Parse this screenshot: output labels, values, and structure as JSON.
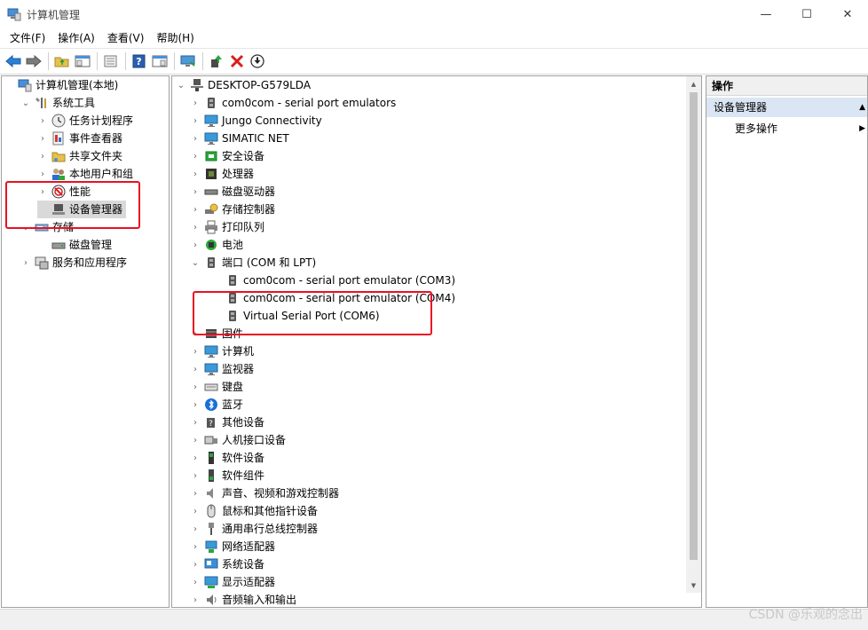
{
  "window": {
    "title": "计算机管理",
    "minimize": "—",
    "maximize": "☐",
    "close": "✕"
  },
  "menu": [
    "文件(F)",
    "操作(A)",
    "查看(V)",
    "帮助(H)"
  ],
  "toolbar_icons": [
    "back-arrow-icon",
    "forward-arrow-icon",
    "up-folder-icon",
    "show-hide-tree-icon",
    "properties-icon",
    "help-icon",
    "action-pane-icon",
    "monitor-icon",
    "update-driver-icon",
    "uninstall-icon",
    "download-icon"
  ],
  "left_tree": [
    {
      "label": "计算机管理(本地)",
      "arrow": "",
      "depth": 0,
      "icon": "computer-management-icon"
    },
    {
      "label": "系统工具",
      "arrow": "⌄",
      "depth": 1,
      "icon": "tools-icon"
    },
    {
      "label": "任务计划程序",
      "arrow": "›",
      "depth": 2,
      "icon": "clock-icon"
    },
    {
      "label": "事件查看器",
      "arrow": "›",
      "depth": 2,
      "icon": "event-viewer-icon"
    },
    {
      "label": "共享文件夹",
      "arrow": "›",
      "depth": 2,
      "icon": "shared-folder-icon"
    },
    {
      "label": "本地用户和组",
      "arrow": "›",
      "depth": 2,
      "icon": "users-icon"
    },
    {
      "label": "性能",
      "arrow": "›",
      "depth": 2,
      "icon": "performance-icon"
    },
    {
      "label": "设备管理器",
      "arrow": "",
      "depth": 2,
      "icon": "device-manager-icon",
      "selected": true
    },
    {
      "label": "存储",
      "arrow": "⌄",
      "depth": 1,
      "icon": "storage-icon"
    },
    {
      "label": "磁盘管理",
      "arrow": "",
      "depth": 2,
      "icon": "disk-icon"
    },
    {
      "label": "服务和应用程序",
      "arrow": "›",
      "depth": 1,
      "icon": "services-icon"
    }
  ],
  "device_tree": {
    "root": "DESKTOP-G579LDA",
    "items": [
      {
        "label": "com0com - serial port emulators",
        "depth": 1,
        "arrow": "›",
        "icon": "port-icon"
      },
      {
        "label": "Jungo Connectivity",
        "depth": 1,
        "arrow": "›",
        "icon": "monitor-icon"
      },
      {
        "label": "SIMATIC NET",
        "depth": 1,
        "arrow": "›",
        "icon": "monitor-icon"
      },
      {
        "label": "安全设备",
        "depth": 1,
        "arrow": "›",
        "icon": "security-icon"
      },
      {
        "label": "处理器",
        "depth": 1,
        "arrow": "›",
        "icon": "processor-icon"
      },
      {
        "label": "磁盘驱动器",
        "depth": 1,
        "arrow": "›",
        "icon": "disk-drive-icon"
      },
      {
        "label": "存储控制器",
        "depth": 1,
        "arrow": "›",
        "icon": "storage-controller-icon"
      },
      {
        "label": "打印队列",
        "depth": 1,
        "arrow": "›",
        "icon": "printer-icon"
      },
      {
        "label": "电池",
        "depth": 1,
        "arrow": "›",
        "icon": "battery-icon"
      },
      {
        "label": "端口 (COM 和 LPT)",
        "depth": 1,
        "arrow": "⌄",
        "icon": "port-icon"
      },
      {
        "label": "com0com - serial port emulator (COM3)",
        "depth": 2,
        "arrow": "",
        "icon": "port-icon"
      },
      {
        "label": "com0com - serial port emulator (COM4)",
        "depth": 2,
        "arrow": "",
        "icon": "port-icon"
      },
      {
        "label": "Virtual Serial Port (COM6)",
        "depth": 2,
        "arrow": "",
        "icon": "port-icon"
      },
      {
        "label": "固件",
        "depth": 1,
        "arrow": "›",
        "icon": "firmware-icon"
      },
      {
        "label": "计算机",
        "depth": 1,
        "arrow": "›",
        "icon": "monitor-icon"
      },
      {
        "label": "监视器",
        "depth": 1,
        "arrow": "›",
        "icon": "monitor-icon"
      },
      {
        "label": "键盘",
        "depth": 1,
        "arrow": "›",
        "icon": "keyboard-icon"
      },
      {
        "label": "蓝牙",
        "depth": 1,
        "arrow": "›",
        "icon": "bluetooth-icon"
      },
      {
        "label": "其他设备",
        "depth": 1,
        "arrow": "›",
        "icon": "unknown-device-icon"
      },
      {
        "label": "人机接口设备",
        "depth": 1,
        "arrow": "›",
        "icon": "hid-icon"
      },
      {
        "label": "软件设备",
        "depth": 1,
        "arrow": "›",
        "icon": "software-device-icon"
      },
      {
        "label": "软件组件",
        "depth": 1,
        "arrow": "›",
        "icon": "software-component-icon"
      },
      {
        "label": "声音、视频和游戏控制器",
        "depth": 1,
        "arrow": "›",
        "icon": "speaker-icon"
      },
      {
        "label": "鼠标和其他指针设备",
        "depth": 1,
        "arrow": "›",
        "icon": "mouse-icon"
      },
      {
        "label": "通用串行总线控制器",
        "depth": 1,
        "arrow": "›",
        "icon": "usb-icon"
      },
      {
        "label": "网络适配器",
        "depth": 1,
        "arrow": "›",
        "icon": "network-icon"
      },
      {
        "label": "系统设备",
        "depth": 1,
        "arrow": "›",
        "icon": "system-device-icon"
      },
      {
        "label": "显示适配器",
        "depth": 1,
        "arrow": "›",
        "icon": "display-adapter-icon"
      },
      {
        "label": "音频输入和输出",
        "depth": 1,
        "arrow": "›",
        "icon": "audio-icon"
      }
    ]
  },
  "actions": {
    "header": "操作",
    "section": "设备管理器",
    "section_arrow": "▲",
    "more": "更多操作",
    "more_arrow": "▶"
  },
  "watermark": "CSDN @乐观的念出",
  "colors": {
    "highlight_box": "#e81123",
    "selection": "#d9d9d9",
    "actions_section_bg": "#dbe6f4"
  }
}
